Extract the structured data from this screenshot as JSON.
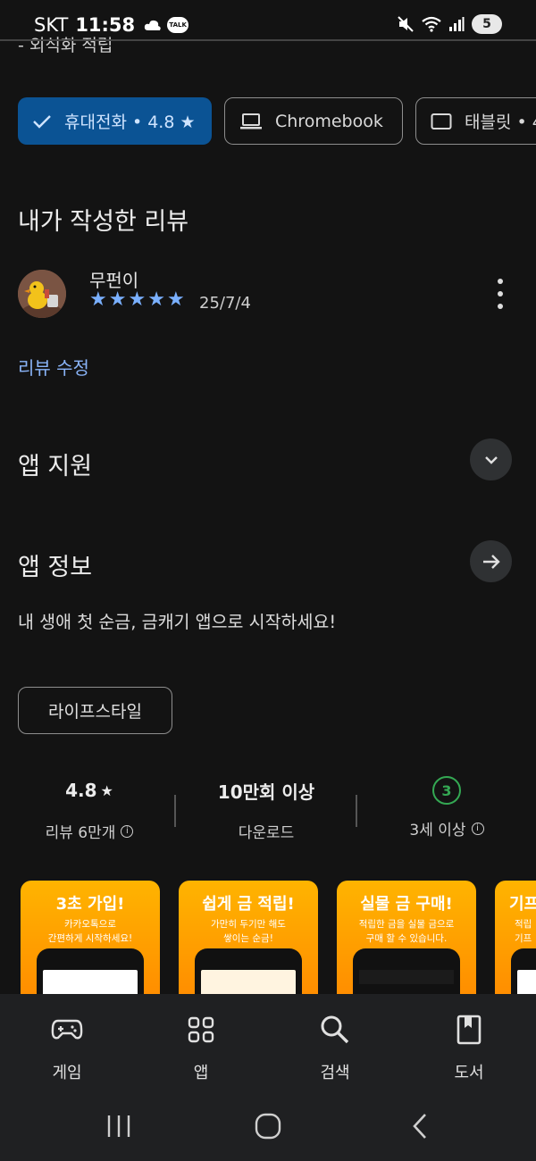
{
  "status": {
    "carrier": "SKT",
    "time": "11:58",
    "battery": "5",
    "talk_badge": "TALK"
  },
  "cut_text": "- 외식화 적립",
  "device_chips": [
    {
      "label": "휴대전화 • 4.8 ★",
      "selected": true,
      "icon": "check-icon"
    },
    {
      "label": "Chromebook",
      "selected": false,
      "icon": "laptop-icon"
    },
    {
      "label": "태블릿 • 4",
      "selected": false,
      "icon": "tablet-icon"
    }
  ],
  "my_review": {
    "heading": "내가 작성한 리뷰",
    "reviewer": "무펀이",
    "rating": 5,
    "date": "25/7/4",
    "edit_label": "리뷰 수정"
  },
  "app_support": {
    "heading": "앱 지원"
  },
  "app_info": {
    "heading": "앱 정보",
    "description": "내 생애 첫 순금, 금캐기 앱으로 시작하세요!",
    "tag": "라이프스타일"
  },
  "stats": {
    "rating_value": "4.8",
    "rating_label": "리뷰 6만개",
    "downloads_value": "10만회 이상",
    "downloads_label": "다운로드",
    "age_value": "3",
    "age_label": "3세 이상"
  },
  "screenshots": [
    {
      "title": "3초 가입!",
      "sub": "카카오톡으로\n간편하게 시작하세요!"
    },
    {
      "title": "쉽게 금 적립!",
      "sub": "가만히 두기만 해도\n쌓이는 순금!"
    },
    {
      "title": "실물 금 구매!",
      "sub": "적립한 금을 실물 금으로\n구매 할 수 있습니다."
    },
    {
      "title": "기프",
      "sub": "적립\n기프"
    }
  ],
  "bottom_nav": [
    {
      "label": "게임",
      "icon": "gamepad-icon"
    },
    {
      "label": "앱",
      "icon": "apps-grid-icon"
    },
    {
      "label": "검색",
      "icon": "search-icon"
    },
    {
      "label": "도서",
      "icon": "book-icon"
    }
  ],
  "colors": {
    "background": "#131313",
    "accent_blue": "#0b5394",
    "link_blue": "#8ab4f8",
    "star_blue": "#7ab0ff",
    "age_green": "#34a853"
  }
}
